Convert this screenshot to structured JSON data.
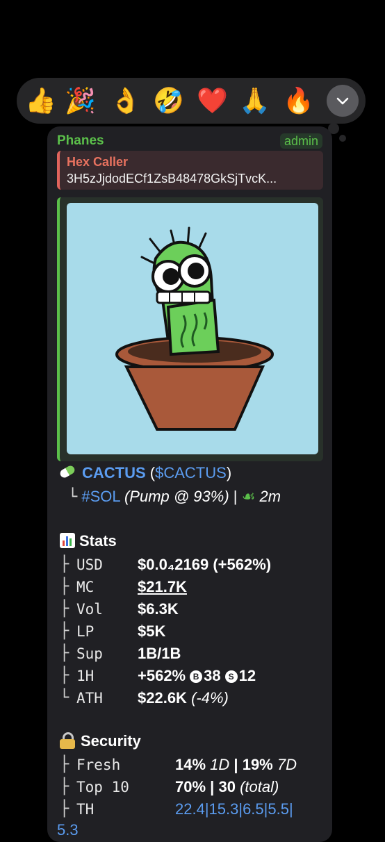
{
  "reactions": [
    "👍",
    "🎉",
    "👌",
    "🤣",
    "❤️",
    "🙏",
    "🔥"
  ],
  "message": {
    "sender": "Phanes",
    "badge": "admin",
    "reply": {
      "name": "Hex Caller",
      "text": "3H5zJjdodECf1ZsB48478GkSjTvcK..."
    },
    "token": {
      "name": "CACTUS",
      "symbol_open": "(",
      "symbol": "$CACTUS",
      "symbol_close": ")",
      "branch": "└",
      "chain": "#SOL",
      "pump": "(Pump @ 93%)",
      "separator": "|",
      "age": "2m"
    },
    "stats": {
      "title": "Stats",
      "rows": [
        {
          "branch": "├",
          "label": "USD",
          "value": "$0.0₄2169 (+562%)"
        },
        {
          "branch": "├",
          "label": "MC",
          "value": "$21.7K"
        },
        {
          "branch": "├",
          "label": "Vol",
          "value": "$6.3K"
        },
        {
          "branch": "├",
          "label": "LP",
          "value": "$5K"
        },
        {
          "branch": "├",
          "label": "Sup",
          "value": "1B/1B"
        },
        {
          "branch": "├",
          "label": "1H",
          "value": "+562%"
        },
        {
          "branch": "└",
          "label": "ATH",
          "value": "$22.6K"
        }
      ],
      "buys": "38",
      "sells": "12",
      "buy_icon": "B",
      "sell_icon": "S",
      "ath_change": "(-4%)"
    },
    "security": {
      "title": "Security",
      "fresh_label": "Fresh",
      "fresh_1d": "14%",
      "fresh_1d_unit": "1D",
      "fresh_sep": "|",
      "fresh_7d": "19%",
      "fresh_7d_unit": "7D",
      "top10_label": "Top 10",
      "top10_pct": "70%",
      "top10_sep": "|",
      "top10_count": "30",
      "top10_total": "(total)",
      "th_label": "TH",
      "th_values": "22.4|15.3|6.5|5.5|",
      "th_overflow": "5.3"
    }
  },
  "colors": {
    "accent_blue": "#5b9cf0",
    "sender_green": "#5bbf4a",
    "reply_red": "#e8725f"
  }
}
